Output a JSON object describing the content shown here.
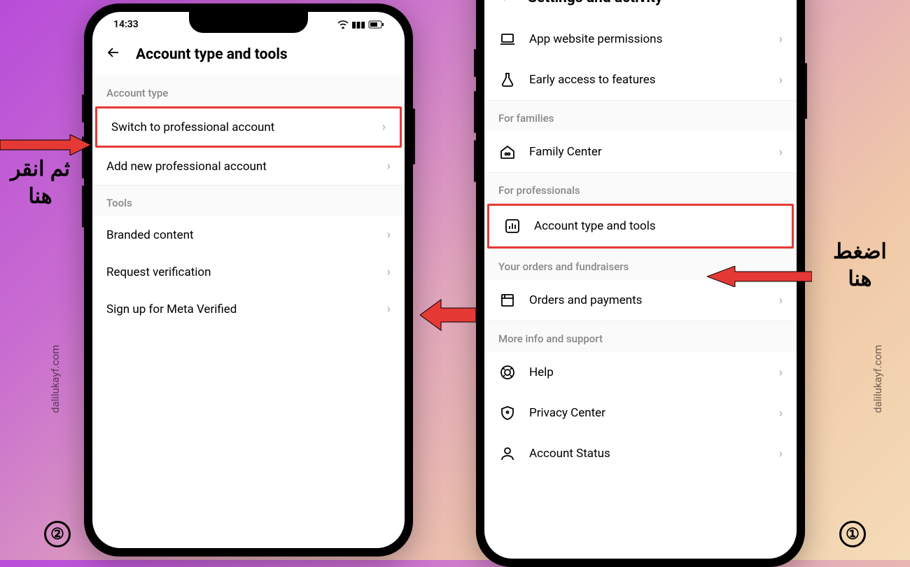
{
  "left_phone": {
    "time": "14:33",
    "header_title": "Account type and tools",
    "sections": {
      "account_type": {
        "header": "Account type",
        "switch_pro": "Switch to professional account",
        "add_pro": "Add new professional account"
      },
      "tools": {
        "header": "Tools",
        "branded": "Branded content",
        "verify": "Request verification",
        "meta": "Sign up for Meta Verified"
      }
    }
  },
  "right_phone": {
    "header_title": "Settings and activity",
    "rows": {
      "app_perms": "App website permissions",
      "early_access": "Early access to features",
      "families_header": "For families",
      "family_center": "Family Center",
      "pros_header": "For professionals",
      "account_tools": "Account type and tools",
      "orders_header": "Your orders and fundraisers",
      "orders_pay": "Orders and payments",
      "support_header": "More info and support",
      "help": "Help",
      "privacy": "Privacy Center",
      "status": "Account Status"
    }
  },
  "annotations": {
    "left_label": "ثم انقر\nهنا",
    "right_label": "اضغط\nهنا",
    "step1": "①",
    "step2": "②",
    "watermark": "dalilukayf.com"
  }
}
